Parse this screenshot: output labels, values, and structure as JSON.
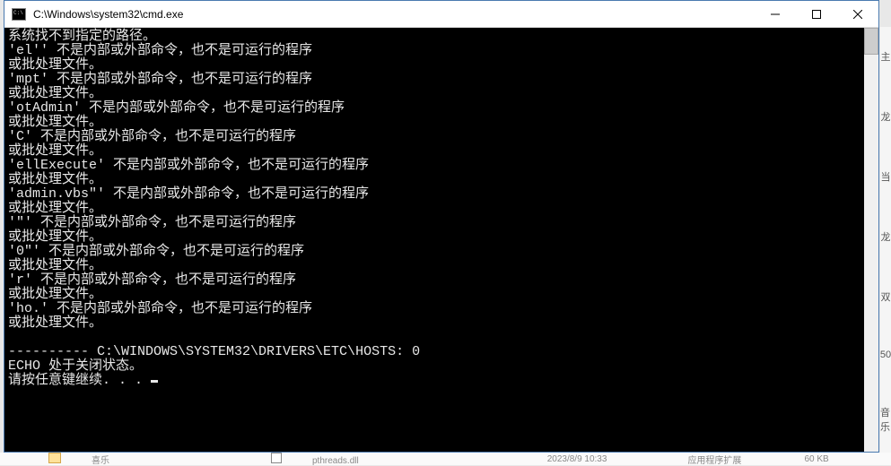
{
  "window": {
    "title": "C:\\Windows\\system32\\cmd.exe"
  },
  "terminal": {
    "lines": [
      "系统找不到指定的路径。",
      "'el'' 不是内部或外部命令，也不是可运行的程序",
      "或批处理文件。",
      "'mpt' 不是内部或外部命令，也不是可运行的程序",
      "或批处理文件。",
      "'otAdmin' 不是内部或外部命令，也不是可运行的程序",
      "或批处理文件。",
      "'C' 不是内部或外部命令，也不是可运行的程序",
      "或批处理文件。",
      "'ellExecute' 不是内部或外部命令，也不是可运行的程序",
      "或批处理文件。",
      "'admin.vbs\"' 不是内部或外部命令，也不是可运行的程序",
      "或批处理文件。",
      "'\"' 不是内部或外部命令，也不是可运行的程序",
      "或批处理文件。",
      "'0\"' 不是内部或外部命令，也不是可运行的程序",
      "或批处理文件。",
      "'r' 不是内部或外部命令，也不是可运行的程序",
      "或批处理文件。",
      "'ho.' 不是内部或外部命令，也不是可运行的程序",
      "或批处理文件。",
      "",
      "---------- C:\\WINDOWS\\SYSTEM32\\DRIVERS\\ETC\\HOSTS: 0",
      "ECHO 处于关闭状态。",
      "请按任意键继续. . . "
    ]
  },
  "background": {
    "sidebar": [
      "主",
      "龙",
      "当",
      "龙",
      "双",
      "50",
      "音乐"
    ],
    "bottom": {
      "item1": "喜乐",
      "item2": "pthreads.dll",
      "date": "2023/8/9 10:33",
      "type": "应用程序扩展",
      "size": "60 KB"
    }
  }
}
